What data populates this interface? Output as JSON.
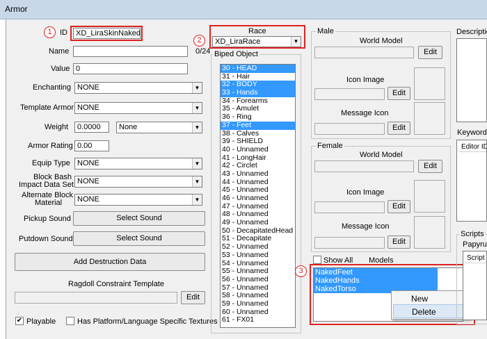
{
  "window": {
    "title": "Armor"
  },
  "colors": {
    "annotation": "#e02020",
    "selection": "#3399ff"
  },
  "annotations": [
    "1",
    "2",
    "3"
  ],
  "fields": {
    "id_label": "ID",
    "id_value": "XD_LiraSkinNaked",
    "name_label": "Name",
    "name_value": "",
    "name_count": "0/24",
    "value_label": "Value",
    "value_value": "0",
    "enchanting_label": "Enchanting",
    "enchanting_value": "NONE",
    "template_label": "Template Armor",
    "template_value": "NONE",
    "weight_label": "Weight",
    "weight_value": "0.0000",
    "weight_type": "None",
    "armor_rating_label": "Armor Rating",
    "armor_rating_value": "0.00",
    "equip_type_label": "Equip Type",
    "equip_type_value": "NONE",
    "block_bash_label_1": "Block Bash",
    "block_bash_label_2": "Impact Data Set",
    "block_bash_value": "NONE",
    "alt_block_label_1": "Alternate Block",
    "alt_block_label_2": "Material",
    "alt_block_value": "NONE",
    "pickup_label": "Pickup Sound",
    "pickup_button": "Select Sound",
    "putdown_label": "Putdown Sound",
    "putdown_button": "Select Sound",
    "destruction_button": "Add Destruction Data",
    "ragdoll_label": "Ragdoll Constraint Template",
    "ragdoll_edit": "Edit",
    "playable_label": "Playable",
    "playable_checked": "✔",
    "platform_label": "Has Platform/Language Specific Textures"
  },
  "race": {
    "label": "Race",
    "value": "XD_LiraRace"
  },
  "biped": {
    "label": "Biped Object",
    "items": [
      {
        "text": "30 - HEAD",
        "selected": true
      },
      {
        "text": "31 - Hair",
        "selected": false
      },
      {
        "text": "32 - BODY",
        "selected": true
      },
      {
        "text": "33 - Hands",
        "selected": true
      },
      {
        "text": "34 - Forearms",
        "selected": false
      },
      {
        "text": "35 - Amulet",
        "selected": false
      },
      {
        "text": "36 - Ring",
        "selected": false
      },
      {
        "text": "37 - Feet",
        "selected": true
      },
      {
        "text": "38 - Calves",
        "selected": false
      },
      {
        "text": "39 - SHIELD",
        "selected": false
      },
      {
        "text": "40 - Unnamed",
        "selected": false
      },
      {
        "text": "41 - LongHair",
        "selected": false
      },
      {
        "text": "42 - Circlet",
        "selected": false
      },
      {
        "text": "43 - Unnamed",
        "selected": false
      },
      {
        "text": "44 - Unnamed",
        "selected": false
      },
      {
        "text": "45 - Unnamed",
        "selected": false
      },
      {
        "text": "46 - Unnamed",
        "selected": false
      },
      {
        "text": "47 - Unnamed",
        "selected": false
      },
      {
        "text": "48 - Unnamed",
        "selected": false
      },
      {
        "text": "49 - Unnamed",
        "selected": false
      },
      {
        "text": "50 - DecapitatedHead",
        "selected": false
      },
      {
        "text": "51 - Decapitate",
        "selected": false
      },
      {
        "text": "52 - Unnamed",
        "selected": false
      },
      {
        "text": "53 - Unnamed",
        "selected": false
      },
      {
        "text": "54 - Unnamed",
        "selected": false
      },
      {
        "text": "55 - Unnamed",
        "selected": false
      },
      {
        "text": "56 - Unnamed",
        "selected": false
      },
      {
        "text": "57 - Unnamed",
        "selected": false
      },
      {
        "text": "58 - Unnamed",
        "selected": false
      },
      {
        "text": "59 - Unnamed",
        "selected": false
      },
      {
        "text": "60 - Unnamed",
        "selected": false
      },
      {
        "text": "61 - FX01",
        "selected": false
      }
    ]
  },
  "male": {
    "label": "Male",
    "world_model": "World Model",
    "icon_image": "Icon Image",
    "message_icon": "Message Icon",
    "edit": "Edit"
  },
  "female": {
    "label": "Female",
    "world_model": "World Model",
    "icon_image": "Icon Image",
    "message_icon": "Message Icon",
    "edit": "Edit"
  },
  "models": {
    "show_all": "Show All",
    "label": "Models",
    "items": [
      "NakedFeet",
      "NakedHands",
      "NakedTorso"
    ]
  },
  "context_menu": {
    "new": "New",
    "delete": "Delete"
  },
  "right_panel": {
    "description": "Description",
    "keywords": "Keywords",
    "editor_id": "Editor ID",
    "scripts": "Scripts",
    "papyrus": "Papyrus",
    "script_col": "Script N"
  }
}
